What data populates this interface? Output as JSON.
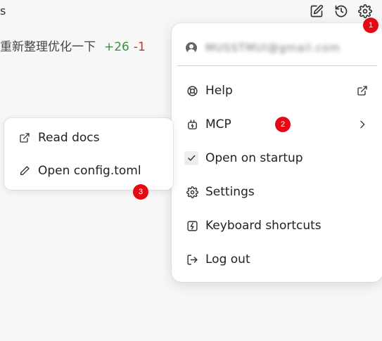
{
  "header": {
    "left_fragment": "s",
    "icons": [
      "edit-icon",
      "history-icon",
      "gear-icon"
    ]
  },
  "message": {
    "text": "重新整理优化一下",
    "additions": "+26",
    "deletions": "-1"
  },
  "menu": {
    "account_email": "MUSSTMUI@gmail.com",
    "items": [
      {
        "label": "Help",
        "icon": "lifebuoy-icon",
        "trail": "external-link-icon"
      },
      {
        "label": "MCP",
        "icon": "plug-icon",
        "trail": "chevron-right-icon"
      },
      {
        "label": "Open on startup",
        "icon": "checkbox-checked-icon"
      },
      {
        "label": "Settings",
        "icon": "gear-icon"
      },
      {
        "label": "Keyboard shortcuts",
        "icon": "keyboard-shortcut-icon"
      },
      {
        "label": "Log out",
        "icon": "logout-icon"
      }
    ]
  },
  "submenu": {
    "items": [
      {
        "label": "Read docs",
        "icon": "external-link-icon"
      },
      {
        "label": "Open config.toml",
        "icon": "pencil-icon"
      }
    ]
  },
  "badges": [
    "1",
    "2",
    "3"
  ],
  "colors": {
    "badge": "#e50914",
    "additions": "#3e8e3e",
    "deletions": "#c53030",
    "background": "#f7f7f7"
  }
}
